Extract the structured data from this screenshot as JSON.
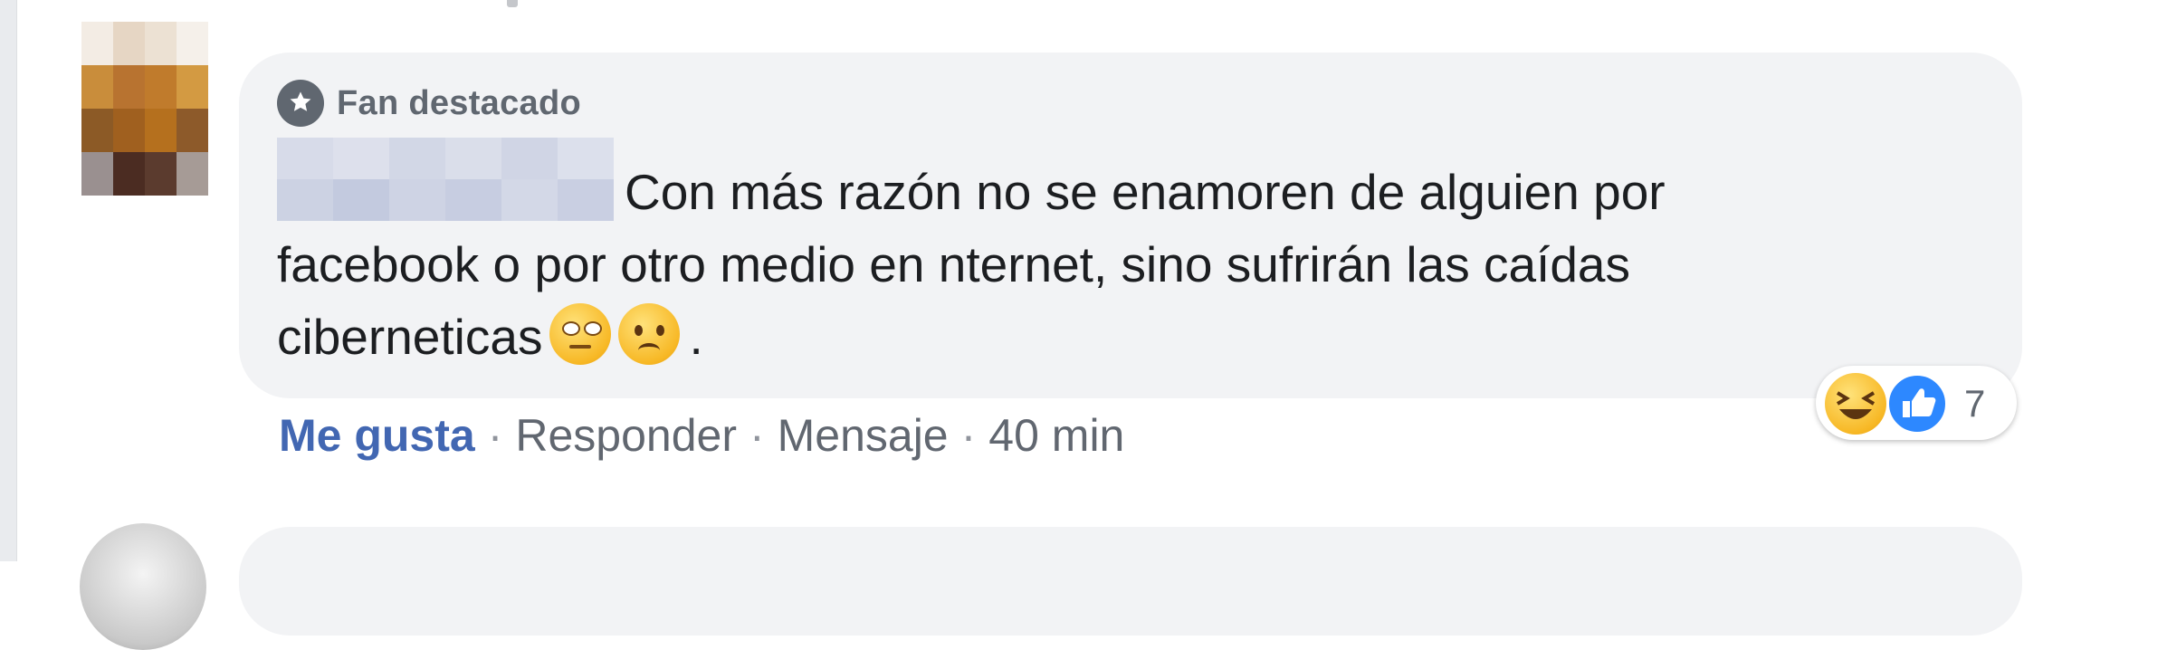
{
  "comment": {
    "badge_label": "Fan destacado",
    "text": "Con más razón no se enamoren de alguien por facebook o por otro medio en nternet, sino sufrirán las caídas ciberneticas",
    "trailing": ".",
    "emojis": [
      "face-with-rolling-eyes",
      "worried-face"
    ]
  },
  "actions": {
    "like": "Me gusta",
    "reply": "Responder",
    "message": "Mensaje",
    "time": "40 min",
    "separator": "·"
  },
  "reactions": {
    "types": [
      "haha",
      "like"
    ],
    "count": "7"
  },
  "colors": {
    "bubble": "#f2f3f5",
    "link_blue": "#4267b2",
    "meta_gray": "#616770",
    "reaction_like": "#2d88ff"
  }
}
